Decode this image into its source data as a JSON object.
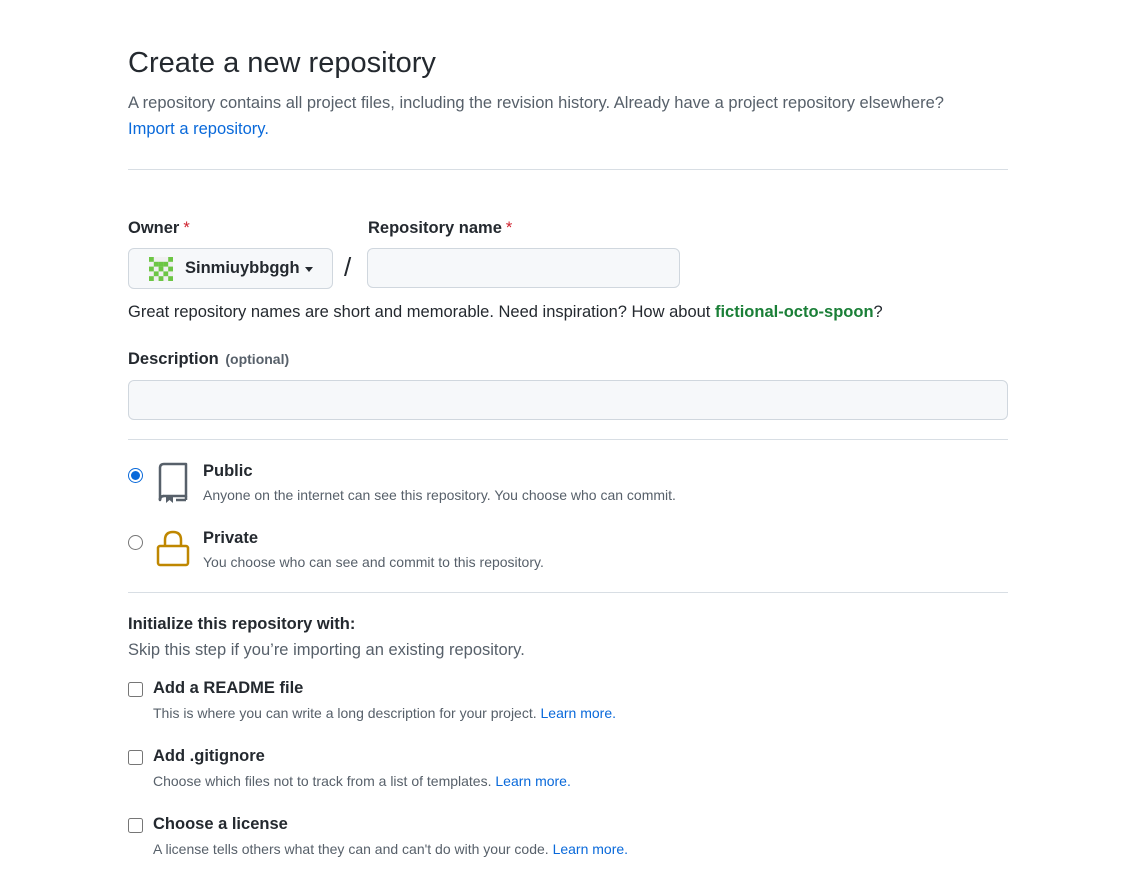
{
  "header": {
    "title": "Create a new repository",
    "subtitle": "A repository contains all project files, including the revision history. Already have a project repository elsewhere?",
    "import_link": "Import a repository."
  },
  "owner": {
    "label": "Owner",
    "required_mark": "*",
    "selected": "Sinmiuybbggh",
    "avatar_icon": "identicon-avatar"
  },
  "repo_name": {
    "label": "Repository name",
    "required_mark": "*",
    "value": "",
    "separator": "/"
  },
  "name_hint": {
    "prefix": "Great repository names are short and memorable. Need inspiration? How about ",
    "suggestion": "fictional-octo-spoon",
    "suffix": "?"
  },
  "description": {
    "label": "Description",
    "optional": "(optional)",
    "value": ""
  },
  "visibility": {
    "public": {
      "title": "Public",
      "desc": "Anyone on the internet can see this repository. You choose who can commit.",
      "checked": true,
      "icon": "repo-icon"
    },
    "private": {
      "title": "Private",
      "desc": "You choose who can see and commit to this repository.",
      "checked": false,
      "icon": "lock-icon"
    }
  },
  "init": {
    "title": "Initialize this repository with:",
    "subtitle": "Skip this step if you’re importing an existing repository.",
    "options": [
      {
        "title": "Add a README file",
        "desc": "This is where you can write a long description for your project.",
        "link": "Learn more."
      },
      {
        "title": "Add .gitignore",
        "desc": "Choose which files not to track from a list of templates.",
        "link": "Learn more."
      },
      {
        "title": "Choose a license",
        "desc": "A license tells others what they can and can't do with your code.",
        "link": "Learn more."
      }
    ]
  },
  "colors": {
    "link": "#0969da",
    "suggestion": "#1a7f37",
    "required": "#cf222e",
    "lock": "#bf8700",
    "avatar": "#6cc644"
  }
}
